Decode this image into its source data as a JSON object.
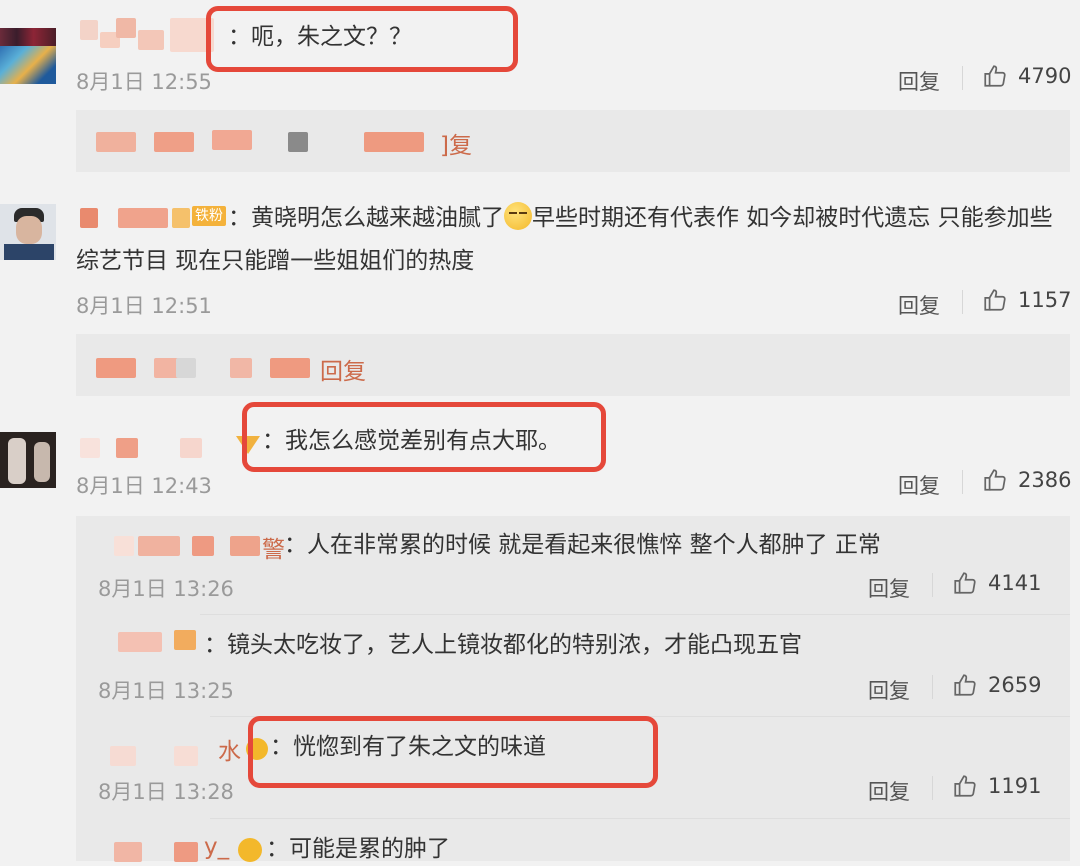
{
  "comments": [
    {
      "text": "：呃，朱之文？？",
      "time": "8月1日 12:55",
      "reply": "回复",
      "likes": "4790",
      "sub_reply_suffix": "]复"
    },
    {
      "fan_badge": "铁粉",
      "text_line1": "：黄晓明怎么越来越油腻了",
      "text_line1b": "早些时期还有代表作 如今却被时代遗忘 只能参加些",
      "text_line2": "综艺节目 现在只能蹭一些姐姐们的热度",
      "time": "8月1日 12:51",
      "reply": "回复",
      "likes": "1157",
      "sub_reply_suffix": "回复"
    },
    {
      "text": "：我怎么感觉差别有点大耶。",
      "time": "8月1日 12:43",
      "reply": "回复",
      "likes": "2386"
    }
  ],
  "sub_comments": [
    {
      "name_tail": "警",
      "text": "：人在非常累的时候 就是看起来很憔悴 整个人都肿了 正常",
      "time": "8月1日 13:26",
      "reply": "回复",
      "likes": "4141"
    },
    {
      "text": "：镜头太吃妆了，艺人上镜妆都化的特别浓，才能凸现五官",
      "time": "8月1日 13:25",
      "reply": "回复",
      "likes": "2659"
    },
    {
      "name_tail": "水",
      "text": "：恍惚到有了朱之文的味道",
      "time": "8月1日 13:28",
      "reply": "回复",
      "likes": "1191"
    },
    {
      "name_tail": "y_",
      "text": "：可能是累的肿了"
    }
  ],
  "icons": {
    "like": "thumbs-up-icon"
  },
  "colors": {
    "highlight_box": "#e5483a"
  }
}
